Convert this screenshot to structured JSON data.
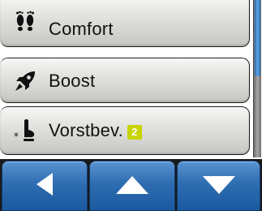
{
  "menu": {
    "items": [
      {
        "label": "Comfort",
        "icon": "footprints-icon",
        "badge": ""
      },
      {
        "label": "Boost",
        "icon": "rocket-icon",
        "badge": ""
      },
      {
        "label": "Vorstbev.",
        "icon": "frost-protection-icon",
        "badge": "2"
      }
    ]
  },
  "nav": {
    "back_icon": "left-arrow-icon",
    "up_icon": "up-arrow-icon",
    "down_icon": "down-arrow-icon"
  },
  "colors": {
    "nav_blue": "#2f6db2",
    "badge_green": "#c8d400",
    "scroll_thumb": "#3d86d0"
  }
}
